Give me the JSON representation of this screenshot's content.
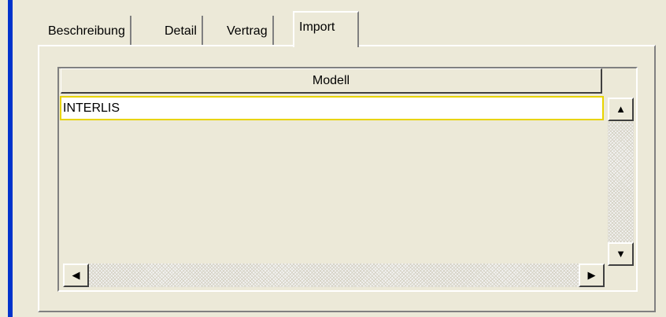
{
  "tabs": [
    {
      "label": "Beschreibung",
      "active": false
    },
    {
      "label": "Detail",
      "active": false
    },
    {
      "label": "Vertrag",
      "active": false
    },
    {
      "label": "Import",
      "active": true
    }
  ],
  "table": {
    "columns": [
      "Modell"
    ],
    "rows": [
      [
        "INTERLIS"
      ]
    ]
  },
  "colors": {
    "face": "#ece9d8",
    "accent_bar": "#0033cc",
    "selection_border": "#e8d400"
  },
  "icons": {
    "up": "triangle-up",
    "down": "triangle-down",
    "left": "triangle-left",
    "right": "triangle-right"
  },
  "glyphs": {
    "up": "▲",
    "down": "▼",
    "left": "◀",
    "right": "▶"
  }
}
